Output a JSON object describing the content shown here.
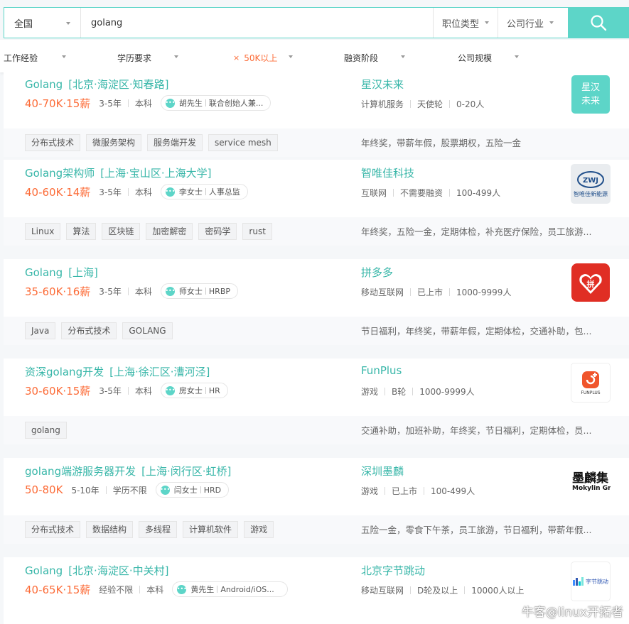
{
  "search": {
    "city": "全国",
    "query": "golang",
    "job_type": "职位类型",
    "industry": "公司行业"
  },
  "filters": {
    "experience": "工作经验",
    "education": "学历要求",
    "salary": "50K以上",
    "funding": "融资阶段",
    "size": "公司规模"
  },
  "jobs": [
    {
      "title": "Golang",
      "area": "[北京·海淀区·知春路]",
      "salary": "40-70K·15薪",
      "exp": "3-5年",
      "edu": "本科",
      "contact_name": "胡先生",
      "contact_role": "联合创始人兼...",
      "tags": [
        "分布式技术",
        "微服务架构",
        "服务端开发",
        "service mesh"
      ],
      "company": "星汉未来",
      "cmeta": [
        "计算机服务",
        "天使轮",
        "0-20人"
      ],
      "benefits": "年终奖，带薪年假，股票期权，五险一金",
      "logo_text": "星汉未来"
    },
    {
      "title": "Golang架构师",
      "area": "[上海·宝山区·上海大学]",
      "salary": "40-60K·14薪",
      "exp": "3-5年",
      "edu": "本科",
      "contact_name": "李女士",
      "contact_role": "人事总监",
      "tags": [
        "Linux",
        "算法",
        "区块链",
        "加密解密",
        "密码学",
        "rust"
      ],
      "company": "智唯佳科技",
      "cmeta": [
        "互联网",
        "不需要融资",
        "100-499人"
      ],
      "benefits": "年终奖，五险一金，定期体检，补充医疗保险，员工旅游...",
      "logo_text": "智唯佳新能源"
    },
    {
      "title": "Golang",
      "area": "[上海]",
      "salary": "35-60K·16薪",
      "exp": "3-5年",
      "edu": "本科",
      "contact_name": "师女士",
      "contact_role": "HRBP",
      "tags": [
        "Java",
        "分布式技术",
        "GOLANG"
      ],
      "company": "拼多多",
      "cmeta": [
        "移动互联网",
        "已上市",
        "1000-9999人"
      ],
      "benefits": "节日福利，年终奖，带薪年假，定期体检，交通补助，包...",
      "logo_text": "拼"
    },
    {
      "title": "资深golang开发",
      "area": "[上海·徐汇区·漕河泾]",
      "salary": "30-60K·15薪",
      "exp": "3-5年",
      "edu": "本科",
      "contact_name": "房女士",
      "contact_role": "HR",
      "tags": [
        "golang"
      ],
      "company": "FunPlus",
      "cmeta": [
        "游戏",
        "B轮",
        "1000-9999人"
      ],
      "benefits": "交通补助，加班补助，年终奖，节日福利，定期体检，员...",
      "logo_text": "FUNPLUS"
    },
    {
      "title": "golang端游服务器开发",
      "area": "[上海·闵行区·虹桥]",
      "salary": "50-80K",
      "exp": "5-10年",
      "edu": "学历不限",
      "contact_name": "闫女士",
      "contact_role": "HRD",
      "tags": [
        "分布式技术",
        "数据结构",
        "多线程",
        "计算机软件",
        "游戏"
      ],
      "company": "深圳墨麟",
      "cmeta": [
        "游戏",
        "已上市",
        "100-499人"
      ],
      "benefits": "五险一金，零食下午茶，员工旅游，节日福利，带薪年假...",
      "logo_text": "墨麟集",
      "logo_sub": "Mokylin Gr"
    },
    {
      "title": "Golang",
      "area": "[北京·海淀区·中关村]",
      "salary": "40-65K·15薪",
      "exp": "经验不限",
      "edu": "本科",
      "contact_name": "黄先生",
      "contact_role": "Android/iOS...",
      "tags": [],
      "company": "北京字节跳动",
      "cmeta": [
        "移动互联网",
        "D轮及以上",
        "10000人以上"
      ],
      "benefits": "",
      "logo_text": "字节跳动"
    }
  ],
  "watermark": "牛客@linux开拓者"
}
